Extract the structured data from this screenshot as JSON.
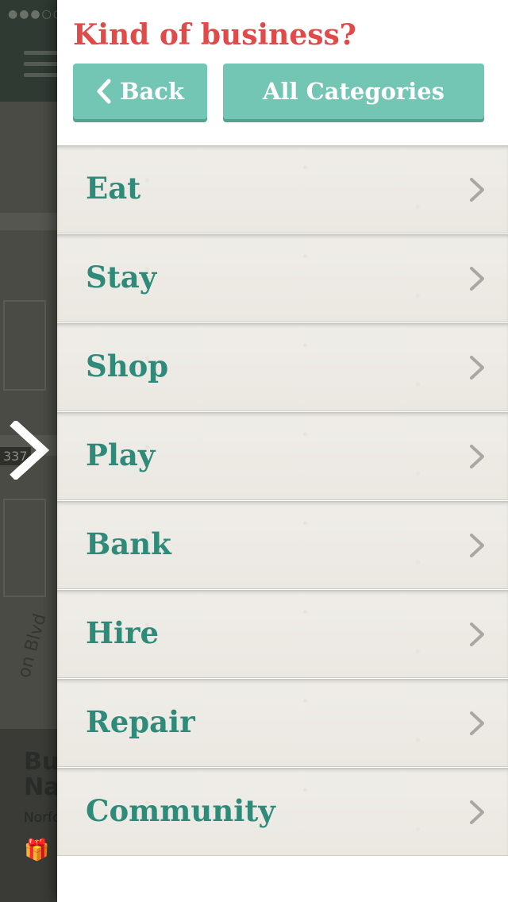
{
  "background": {
    "status_dots": "●●●○○",
    "route_shield": "337",
    "road_label": "on Blvd",
    "card_title": "Bu Na",
    "card_subtitle": "Norfo",
    "gift_icon": "gift-icon"
  },
  "drawer": {
    "title": "Kind of business?",
    "back_label": "Back",
    "all_categories_label": "All Categories",
    "categories": [
      {
        "label": "Eat"
      },
      {
        "label": "Stay"
      },
      {
        "label": "Shop"
      },
      {
        "label": "Play"
      },
      {
        "label": "Bank"
      },
      {
        "label": "Hire"
      },
      {
        "label": "Repair"
      },
      {
        "label": "Community"
      }
    ]
  },
  "colors": {
    "title": "#e04b4a",
    "button": "#74c6b4",
    "category_text": "#2e8a79",
    "row_bg": "#efede8"
  }
}
